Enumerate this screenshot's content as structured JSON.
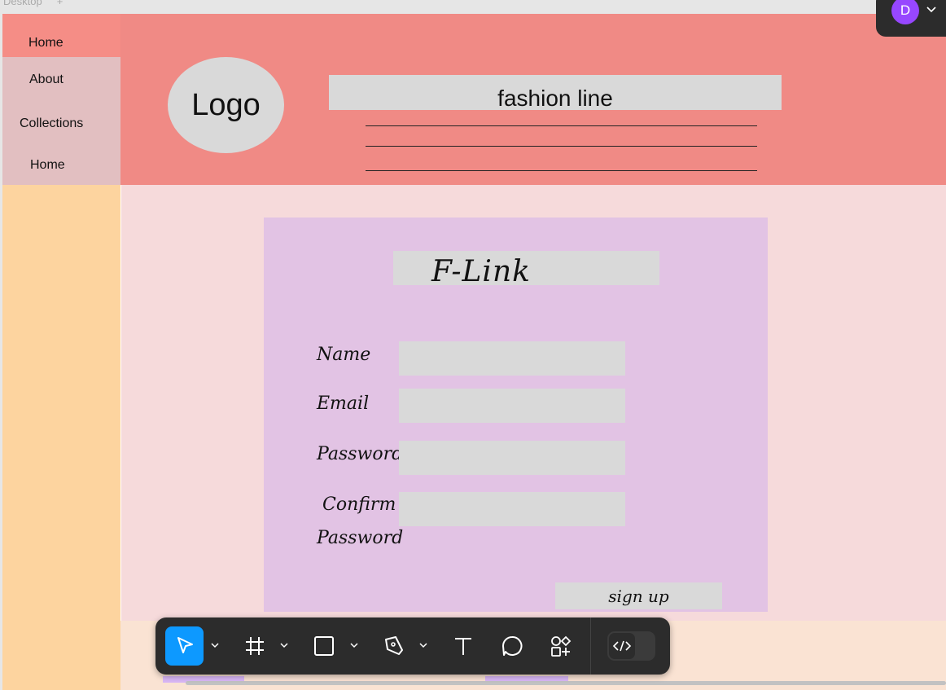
{
  "frame": {
    "label": "Desktop",
    "add_label": "+"
  },
  "sidebar": {
    "items": [
      {
        "label": "Home"
      },
      {
        "label": "About"
      },
      {
        "label": "Collections"
      },
      {
        "label": "Home"
      }
    ]
  },
  "header": {
    "logo_text": "Logo",
    "brand_title": "fashion line"
  },
  "signup_form": {
    "title": "F-Link",
    "fields": [
      {
        "label": "Name",
        "value": ""
      },
      {
        "label": "Email",
        "value": ""
      },
      {
        "label": "Password",
        "value": ""
      },
      {
        "label_line1": "Confirm",
        "label_line2": "Password",
        "value": ""
      }
    ],
    "submit_label": "sign up"
  },
  "toolbar": {
    "tools": [
      {
        "icon": "move-icon",
        "active": true
      },
      {
        "icon": "frame-icon"
      },
      {
        "icon": "rectangle-icon"
      },
      {
        "icon": "pen-icon"
      },
      {
        "icon": "text-icon"
      },
      {
        "icon": "comment-icon"
      },
      {
        "icon": "actions-icon"
      }
    ],
    "dev_mode_icon": "code-icon"
  },
  "user": {
    "avatar_initial": "D"
  },
  "colors": {
    "header": "#f08a85",
    "sidebar": "#fdd49f",
    "card": "#e2c3e4",
    "page": "#f6dadb",
    "accent": "#0d99ff",
    "avatar": "#9747ff"
  }
}
